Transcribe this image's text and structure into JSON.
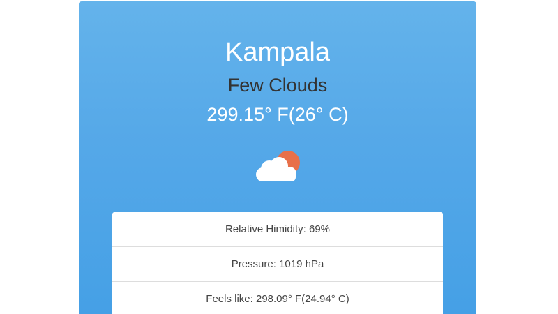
{
  "weather": {
    "city": "Kampala",
    "description": "Few Clouds",
    "temperature": "299.15° F(26° C)",
    "icon": "few-clouds-icon"
  },
  "details": [
    {
      "text": "Relative Himidity: 69%"
    },
    {
      "text": "Pressure: 1019 hPa"
    },
    {
      "text": "Feels like: 298.09° F(24.94° C)"
    }
  ],
  "colors": {
    "card_gradient_top": "#64b3eb",
    "card_gradient_bottom": "#45a0e6",
    "sun": "#e8704a",
    "cloud": "#ffffff"
  }
}
